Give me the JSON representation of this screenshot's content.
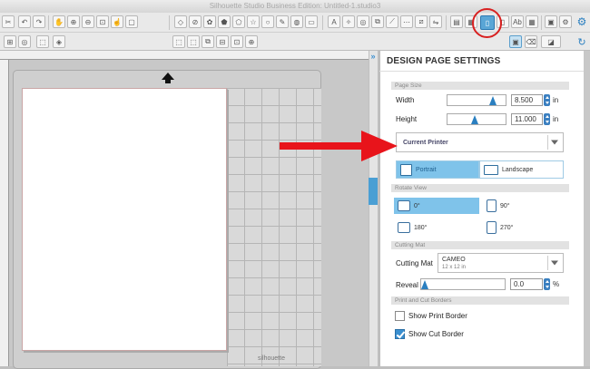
{
  "window": {
    "title": "Silhouette Studio Business Edition: Untitled-1.studio3"
  },
  "toolbar": {
    "text_tool": "A",
    "ab_label": "Ab"
  },
  "panel": {
    "title": "DESIGN PAGE SETTINGS",
    "page_size": {
      "section": "Page Size",
      "width_label": "Width",
      "width_value": "8.500",
      "height_label": "Height",
      "height_value": "11.000",
      "unit": "in",
      "width_slider_level": 0.83,
      "height_slider_level": 0.47,
      "media": "Current Printer",
      "portrait": "Portrait",
      "landscape": "Landscape"
    },
    "rotate_view": {
      "section": "Rotate View",
      "r0": "0°",
      "r90": "90°",
      "r180": "180°",
      "r270": "270°"
    },
    "cutting_mat": {
      "section": "Cutting Mat",
      "label": "Cutting Mat",
      "mat_name": "CAMEO",
      "mat_size": "12 x 12 in",
      "reveal_label": "Reveal",
      "reveal_value": "0.0",
      "reveal_unit": "%",
      "reveal_level": 0.0
    },
    "borders": {
      "section": "Print and Cut Borders",
      "show_print": "Show Print Border",
      "show_print_checked": false,
      "show_cut": "Show Cut Border",
      "show_cut_checked": true
    }
  },
  "canvas": {
    "mat_logo": "silhouette"
  },
  "colors": {
    "accent": "#3a8fd0",
    "annotation": "#e8141b"
  }
}
